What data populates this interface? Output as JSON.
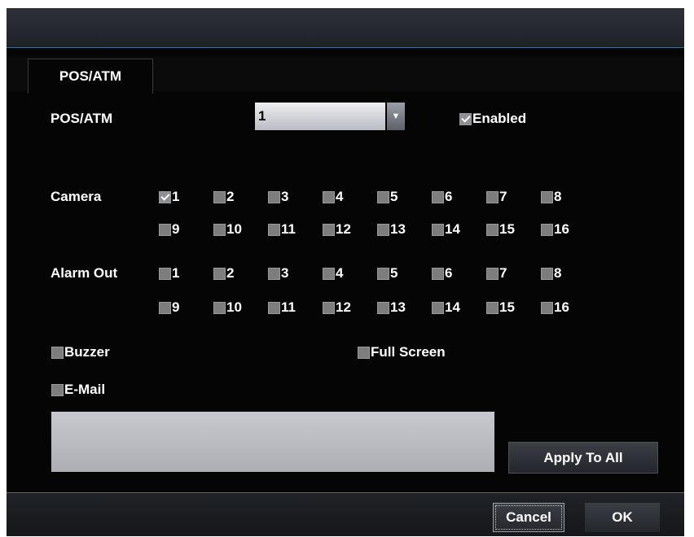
{
  "tab": {
    "label": "POS/ATM"
  },
  "pos_atm": {
    "label": "POS/ATM",
    "selected_value": "1",
    "enabled_label": "Enabled",
    "enabled_checked": true
  },
  "camera": {
    "label": "Camera",
    "items": [
      "1",
      "2",
      "3",
      "4",
      "5",
      "6",
      "7",
      "8",
      "9",
      "10",
      "11",
      "12",
      "13",
      "14",
      "15",
      "16"
    ],
    "checked": [
      true,
      false,
      false,
      false,
      false,
      false,
      false,
      false,
      false,
      false,
      false,
      false,
      false,
      false,
      false,
      false
    ]
  },
  "alarm_out": {
    "label": "Alarm Out",
    "items": [
      "1",
      "2",
      "3",
      "4",
      "5",
      "6",
      "7",
      "8",
      "9",
      "10",
      "11",
      "12",
      "13",
      "14",
      "15",
      "16"
    ],
    "checked": [
      false,
      false,
      false,
      false,
      false,
      false,
      false,
      false,
      false,
      false,
      false,
      false,
      false,
      false,
      false,
      false
    ]
  },
  "options": {
    "buzzer_label": "Buzzer",
    "buzzer_checked": false,
    "full_screen_label": "Full Screen",
    "full_screen_checked": false,
    "email_label": "E-Mail",
    "email_checked": false
  },
  "buttons": {
    "apply_to_all": "Apply To All",
    "cancel": "Cancel",
    "ok": "OK"
  }
}
